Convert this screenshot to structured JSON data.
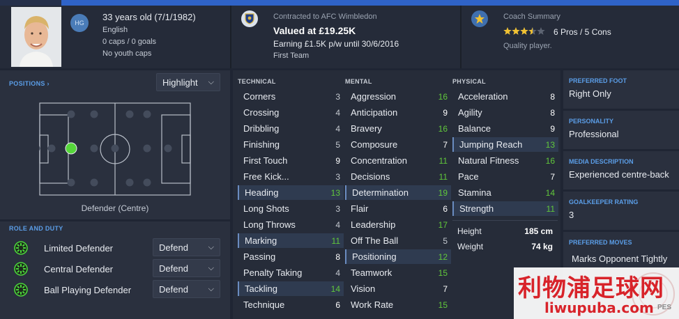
{
  "player": {
    "age_dob": "33 years old (7/1/1982)",
    "nationality": "English",
    "caps": "0 caps / 0 goals",
    "youth_caps": "No youth caps",
    "hg_badge": "HG"
  },
  "contract": {
    "club_line": "Contracted to AFC Wimbledon",
    "value": "Valued at £19.25K",
    "wage": "Earning £1.5K p/w until 30/6/2016",
    "squad": "First Team"
  },
  "coach": {
    "title": "Coach Summary",
    "stars": 3.5,
    "pros_cons": "6 Pros / 5 Cons",
    "verdict": "Quality player."
  },
  "positions": {
    "label": "POSITIONS",
    "dropdown": "Highlight",
    "position_name": "Defender (Centre)"
  },
  "roles": {
    "label": "ROLE AND DUTY",
    "items": [
      {
        "name": "Limited Defender",
        "duty": "Defend"
      },
      {
        "name": "Central Defender",
        "duty": "Defend"
      },
      {
        "name": "Ball Playing Defender",
        "duty": "Defend"
      }
    ]
  },
  "technical": {
    "label": "TECHNICAL",
    "items": [
      {
        "name": "Corners",
        "value": "3",
        "hl": false
      },
      {
        "name": "Crossing",
        "value": "4",
        "hl": false
      },
      {
        "name": "Dribbling",
        "value": "4",
        "hl": false
      },
      {
        "name": "Finishing",
        "value": "5",
        "hl": false
      },
      {
        "name": "First Touch",
        "value": "9",
        "hl": false
      },
      {
        "name": "Free Kick...",
        "value": "3",
        "hl": false
      },
      {
        "name": "Heading",
        "value": "13",
        "hl": true
      },
      {
        "name": "Long Shots",
        "value": "3",
        "hl": false
      },
      {
        "name": "Long Throws",
        "value": "4",
        "hl": false
      },
      {
        "name": "Marking",
        "value": "11",
        "hl": true
      },
      {
        "name": "Passing",
        "value": "8",
        "hl": false
      },
      {
        "name": "Penalty Taking",
        "value": "4",
        "hl": false
      },
      {
        "name": "Tackling",
        "value": "14",
        "hl": true
      },
      {
        "name": "Technique",
        "value": "6",
        "hl": false
      }
    ]
  },
  "mental": {
    "label": "MENTAL",
    "items": [
      {
        "name": "Aggression",
        "value": "16",
        "hl": false
      },
      {
        "name": "Anticipation",
        "value": "9",
        "hl": false
      },
      {
        "name": "Bravery",
        "value": "16",
        "hl": false
      },
      {
        "name": "Composure",
        "value": "7",
        "hl": false
      },
      {
        "name": "Concentration",
        "value": "11",
        "hl": false
      },
      {
        "name": "Decisions",
        "value": "11",
        "hl": false
      },
      {
        "name": "Determination",
        "value": "19",
        "hl": true
      },
      {
        "name": "Flair",
        "value": "6",
        "hl": false
      },
      {
        "name": "Leadership",
        "value": "17",
        "hl": false
      },
      {
        "name": "Off The Ball",
        "value": "5",
        "hl": false
      },
      {
        "name": "Positioning",
        "value": "12",
        "hl": true
      },
      {
        "name": "Teamwork",
        "value": "15",
        "hl": false
      },
      {
        "name": "Vision",
        "value": "7",
        "hl": false
      },
      {
        "name": "Work Rate",
        "value": "15",
        "hl": false
      }
    ]
  },
  "physical": {
    "label": "PHYSICAL",
    "items": [
      {
        "name": "Acceleration",
        "value": "8",
        "hl": false
      },
      {
        "name": "Agility",
        "value": "8",
        "hl": false
      },
      {
        "name": "Balance",
        "value": "9",
        "hl": false
      },
      {
        "name": "Jumping Reach",
        "value": "13",
        "hl": true
      },
      {
        "name": "Natural Fitness",
        "value": "16",
        "hl": false
      },
      {
        "name": "Pace",
        "value": "7",
        "hl": false
      },
      {
        "name": "Stamina",
        "value": "14",
        "hl": false
      },
      {
        "name": "Strength",
        "value": "11",
        "hl": true
      }
    ],
    "height_label": "Height",
    "height": "185 cm",
    "weight_label": "Weight",
    "weight": "74 kg"
  },
  "side": {
    "foot_label": "PREFERRED FOOT",
    "foot": "Right Only",
    "personality_label": "PERSONALITY",
    "personality": "Professional",
    "media_label": "MEDIA DESCRIPTION",
    "media": "Experienced centre-back",
    "gk_label": "GOALKEEPER RATING",
    "gk": "3",
    "moves_label": "PREFERRED MOVES",
    "moves": "Marks Opponent Tightly"
  },
  "watermark": {
    "cn": "利物浦足球网",
    "en": "liwupuba.com",
    "corner": "PES"
  },
  "colors": {
    "accent_blue": "#2f63c8",
    "good": "#61c83b",
    "label_blue": "#5b9ee8"
  }
}
